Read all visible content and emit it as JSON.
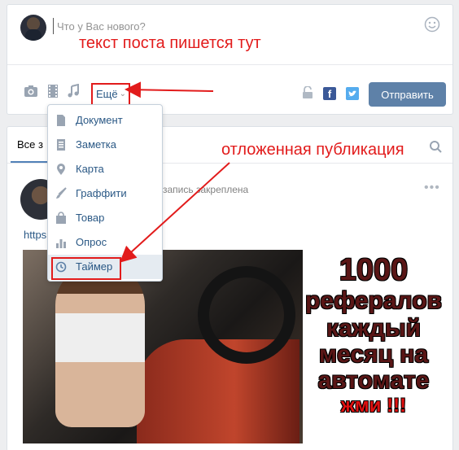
{
  "composer": {
    "placeholder": "Что у Вас нового?",
    "more_label": "Ещё",
    "more_chevron": "⌄",
    "send_label": "Отправить",
    "fb_label": "f"
  },
  "dropdown": {
    "items": [
      {
        "label": "Документ",
        "icon": "document-icon"
      },
      {
        "label": "Заметка",
        "icon": "note-icon"
      },
      {
        "label": "Карта",
        "icon": "map-pin-icon"
      },
      {
        "label": "Граффити",
        "icon": "brush-icon"
      },
      {
        "label": "Товар",
        "icon": "bag-icon"
      },
      {
        "label": "Опрос",
        "icon": "poll-icon"
      },
      {
        "label": "Таймер",
        "icon": "clock-icon"
      }
    ]
  },
  "feed": {
    "tab_label": "Все з",
    "pinned_text": "запись закреплена",
    "link_text": "https                              atch?v=QPskMmYtGZU",
    "dots": "•••"
  },
  "promo": {
    "line1": "1000",
    "line2": "рефералов",
    "line3": "каждый",
    "line4": "месяц на",
    "line5": "автомате",
    "line6": "жми !!!"
  },
  "annotations": {
    "post_text": "текст поста пишется тут",
    "scheduled": "отложенная публикация"
  },
  "colors": {
    "accent": "#5e81a8",
    "link": "#2a5885",
    "annotation": "#e21b1b",
    "facebook": "#3b5998",
    "twitter": "#55acee"
  }
}
